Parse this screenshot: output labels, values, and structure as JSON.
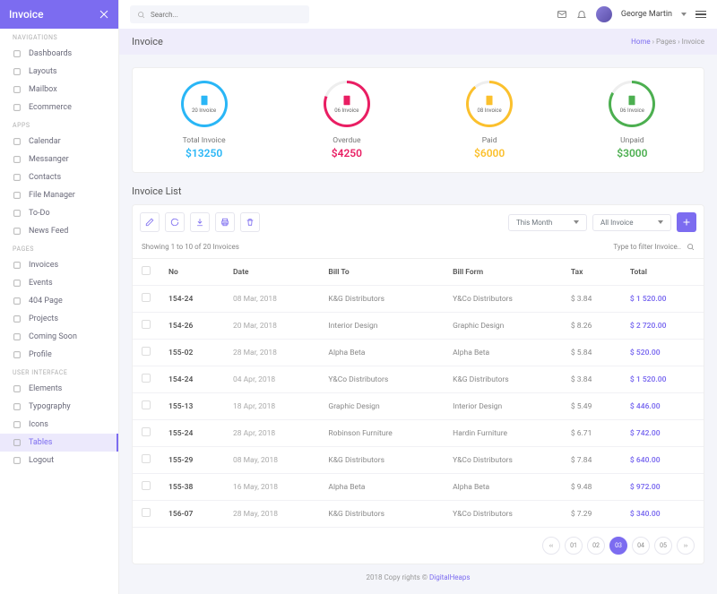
{
  "brand": "Invoice",
  "search_placeholder": "Search...",
  "user": {
    "name": "George Martin"
  },
  "page": {
    "title": "Invoice"
  },
  "breadcrumb": {
    "home": "Home",
    "sep": "›",
    "pages": "Pages",
    "current": "Invoice"
  },
  "nav": {
    "sections": [
      {
        "title": "NAVIGATIONS",
        "items": [
          {
            "label": "Dashboards",
            "icon": "grid"
          },
          {
            "label": "Layouts",
            "icon": "layout"
          },
          {
            "label": "Mailbox",
            "icon": "mail"
          },
          {
            "label": "Ecommerce",
            "icon": "cart"
          }
        ]
      },
      {
        "title": "APPS",
        "items": [
          {
            "label": "Calendar",
            "icon": "calendar"
          },
          {
            "label": "Messanger",
            "icon": "chat"
          },
          {
            "label": "Contacts",
            "icon": "contacts"
          },
          {
            "label": "File Manager",
            "icon": "folder"
          },
          {
            "label": "To-Do",
            "icon": "check"
          },
          {
            "label": "News Feed",
            "icon": "news"
          }
        ]
      },
      {
        "title": "PAGES",
        "items": [
          {
            "label": "Invoices",
            "icon": "invoice"
          },
          {
            "label": "Events",
            "icon": "event"
          },
          {
            "label": "404 Page",
            "icon": "404"
          },
          {
            "label": "Projects",
            "icon": "project"
          },
          {
            "label": "Coming Soon",
            "icon": "clock"
          },
          {
            "label": "Profile",
            "icon": "user"
          }
        ]
      },
      {
        "title": "USER INTERFACE",
        "items": [
          {
            "label": "Elements",
            "icon": "elements"
          },
          {
            "label": "Typography",
            "icon": "type"
          },
          {
            "label": "Icons",
            "icon": "icons"
          },
          {
            "label": "Tables",
            "icon": "tables",
            "active": true
          }
        ]
      },
      {
        "title": "",
        "items": [
          {
            "label": "Logout",
            "icon": "logout"
          }
        ]
      }
    ]
  },
  "stats": [
    {
      "count": "20 Invoice",
      "label": "Total Invoice",
      "value": "$13250",
      "color": "#29b6f6",
      "ring": "blue"
    },
    {
      "count": "06 Invoice",
      "label": "Overdue",
      "value": "$4250",
      "color": "#e91e63",
      "ring": "pink"
    },
    {
      "count": "08 Invoice",
      "label": "Paid",
      "value": "$6000",
      "color": "#fbc02d",
      "ring": "yellow"
    },
    {
      "count": "06 Invoice",
      "label": "Unpaid",
      "value": "$3000",
      "color": "#4caf50",
      "ring": "green"
    }
  ],
  "list": {
    "title": "Invoice List",
    "showing": "Showing 1 to 10 of 20 Invoices",
    "filter_placeholder": "Type to filter Invoice..",
    "period": "This Month",
    "scope": "All Invoice",
    "columns": [
      "No",
      "Date",
      "Bill To",
      "Bill Form",
      "Tax",
      "Total"
    ],
    "rows": [
      {
        "no": "154-24",
        "date": "08 Mar, 2018",
        "to": "K&G Distributors",
        "from": "Y&Co Distributors",
        "tax": "$ 3.84",
        "total": "$ 1 520.00"
      },
      {
        "no": "154-26",
        "date": "20 Mar, 2018",
        "to": "Interior Design",
        "from": "Graphic Design",
        "tax": "$ 8.26",
        "total": "$ 2 720.00"
      },
      {
        "no": "155-02",
        "date": "28 Mar, 2018",
        "to": "Alpha Beta",
        "from": "Alpha Beta",
        "tax": "$ 5.84",
        "total": "$ 520.00"
      },
      {
        "no": "154-24",
        "date": "04 Apr, 2018",
        "to": "Y&Co Distributors",
        "from": "K&G Distributors",
        "tax": "$ 3.84",
        "total": "$ 1 520.00"
      },
      {
        "no": "155-13",
        "date": "18 Apr, 2018",
        "to": "Graphic Design",
        "from": "Interior Design",
        "tax": "$ 5.49",
        "total": "$ 446.00"
      },
      {
        "no": "155-24",
        "date": "28 Apr, 2018",
        "to": "Robinson Furniture",
        "from": "Hardin Furniture",
        "tax": "$ 6.71",
        "total": "$ 742.00"
      },
      {
        "no": "155-29",
        "date": "08 May, 2018",
        "to": "K&G Distributors",
        "from": "Y&Co Distributors",
        "tax": "$ 7.84",
        "total": "$ 640.00"
      },
      {
        "no": "155-38",
        "date": "16 May, 2018",
        "to": "Alpha Beta",
        "from": "Alpha Beta",
        "tax": "$ 9.48",
        "total": "$ 972.00"
      },
      {
        "no": "156-07",
        "date": "28 May, 2018",
        "to": "K&G Distributors",
        "from": "Y&Co Distributors",
        "tax": "$ 7.29",
        "total": "$ 340.00"
      }
    ]
  },
  "pagination": {
    "prev": "‹‹",
    "pages": [
      "01",
      "02",
      "03",
      "04",
      "05"
    ],
    "active": "03",
    "next": "››"
  },
  "footer": {
    "text": "2018 Copy rights © ",
    "link": "DigitalHeaps"
  }
}
